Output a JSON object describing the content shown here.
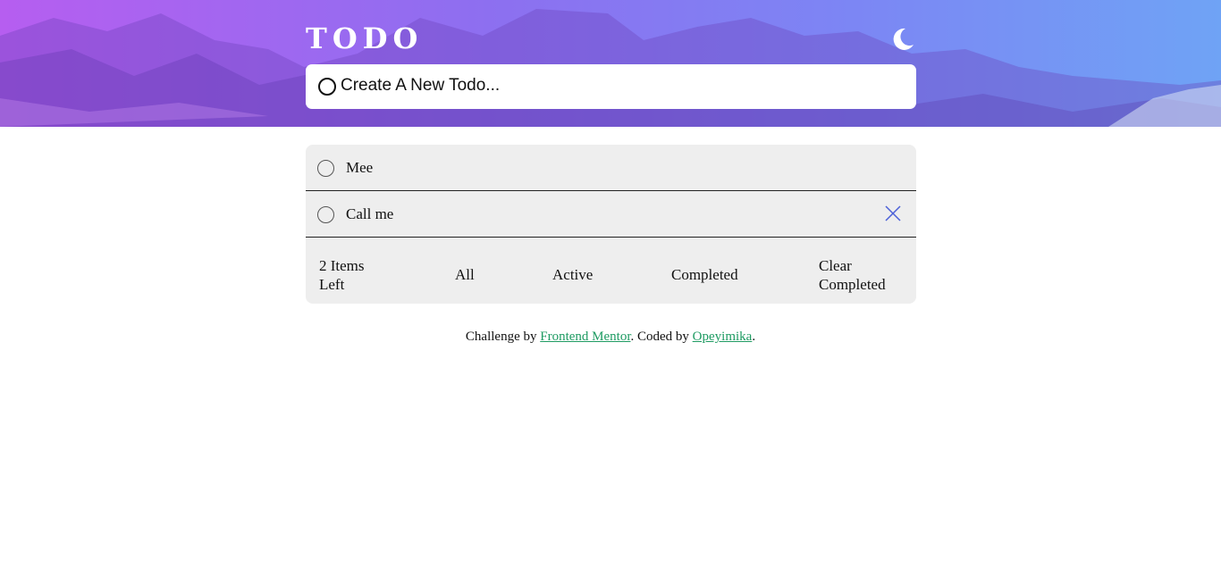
{
  "header": {
    "title": "TODO",
    "theme_toggle_icon": "moon-icon"
  },
  "new_todo": {
    "placeholder": "Create A New Todo...",
    "value": ""
  },
  "todos": [
    {
      "text": "Mee",
      "completed": false,
      "show_delete": false
    },
    {
      "text": "Call me",
      "completed": false,
      "show_delete": true
    }
  ],
  "footer": {
    "items_left": "2 Items Left",
    "filters": [
      "All",
      "Active",
      "Completed"
    ],
    "clear_completed": "Clear Completed"
  },
  "attribution": {
    "prefix": "Challenge by ",
    "link1": "Frontend Mentor",
    "middle": ". Coded by ",
    "link2": "Opeyimika",
    "suffix": "."
  },
  "colors": {
    "gradient_start": "#b65ef0",
    "gradient_end": "#6fa3f5",
    "list_background": "#eeeeee",
    "link": "#1e9b62",
    "delete_icon": "#4a5fd8"
  }
}
